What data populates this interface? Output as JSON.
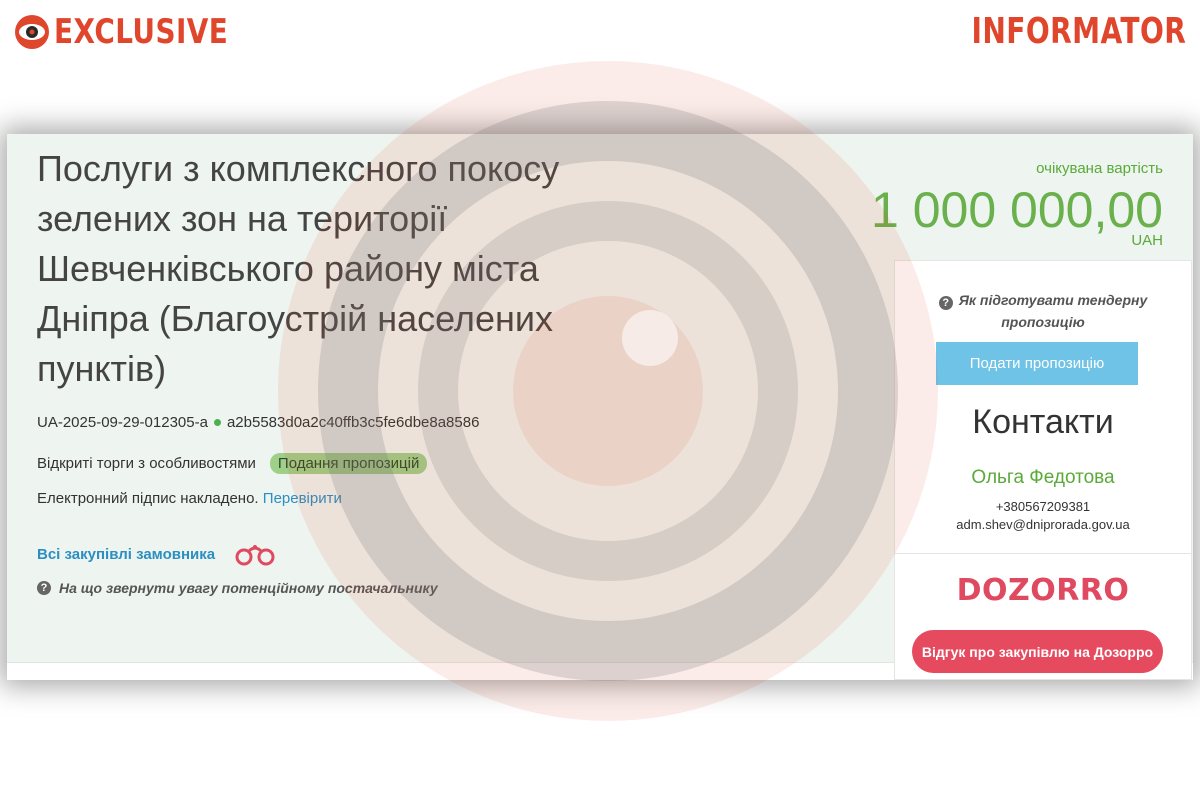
{
  "brand": {
    "left_label": "EXCLUSIVE",
    "right_label": "INFORMATOR"
  },
  "tender": {
    "title": "Послуги з комплексного покосу зелених зон на території Шевченківського району міста Дніпра (Благоустрій населених пунктів)",
    "id": "UA-2025-09-29-012305-a",
    "hash": "a2b5583d0a2c40ffb3c5fe6dbe8a8586",
    "procedure": "Відкриті торги з особливостями",
    "status": "Подання пропозицій",
    "signature_text": "Електронний підпис накладено.",
    "verify_link": "Перевірити",
    "all_purchases_link": "Всі закупівлі замовника",
    "supplier_hint": "На що звернути увагу потенційному постачальнику"
  },
  "value": {
    "label": "очікувана вартість",
    "amount": "1 000 000,00",
    "currency": "UAH"
  },
  "sidebar": {
    "hint": "Як підготувати тендерну пропозицію",
    "submit_button": "Подати пропозицію",
    "contacts_title": "Контакти",
    "contact_name": "Ольга Федотова",
    "contact_phone": "+380567209381",
    "contact_email": "adm.shev@dniprorada.gov.ua",
    "dozorro_logo": "DOZORRO",
    "dozorro_button": "Відгук про закупівлю на Дозорро"
  },
  "icons": {
    "brand_icon": "eye-icon",
    "binoculars": "binoculars-icon",
    "help": "question-circle-icon"
  },
  "colors": {
    "brand_red": "#e0462c",
    "value_green": "#6ab04c",
    "status_badge": "#9ed08a",
    "submit_blue": "#6fc3e6",
    "dozorro_red": "#e54a5f",
    "link_blue": "#2b8fc2"
  }
}
